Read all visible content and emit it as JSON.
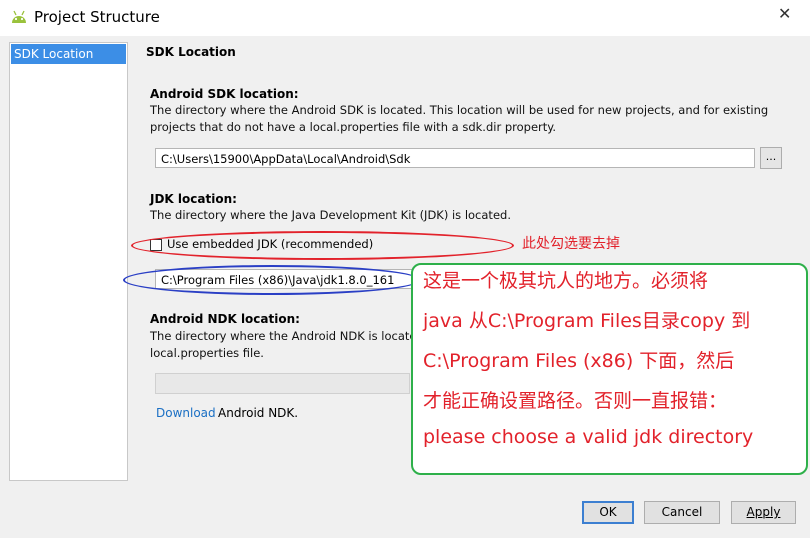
{
  "window": {
    "title": "Project Structure",
    "close_glyph": "✕"
  },
  "sidebar": {
    "items": [
      {
        "label": "SDK Location"
      }
    ]
  },
  "main": {
    "section_title": "SDK Location",
    "android_sdk": {
      "label": "Android SDK location:",
      "desc_line1": "The directory where the Android SDK is located. This location will be used for new projects, and for existing",
      "desc_line2": "projects that do not have a local.properties file with a sdk.dir property.",
      "path": "C:\\Users\\15900\\AppData\\Local\\Android\\Sdk",
      "browse_label": "..."
    },
    "jdk": {
      "label": "JDK location:",
      "desc": "The directory where the Java Development Kit (JDK) is located.",
      "checkbox_label": "Use embedded JDK (recommended)",
      "checkbox_checked": false,
      "path": "C:\\Program Files (x86)\\Java\\jdk1.8.0_161",
      "browse_label": "..."
    },
    "ndk": {
      "label": "Android NDK location:",
      "desc_line1": "The directory where the Android NDK is located. This location will be saved as ndk.dir property in the",
      "desc_line2": "local.properties file.",
      "path": "",
      "download_link": "Download",
      "download_rest": " Android NDK."
    }
  },
  "footer": {
    "ok": "OK",
    "cancel": "Cancel",
    "apply": "Apply"
  },
  "annotations": {
    "red_note": "此处勾选要去掉",
    "green_lines": [
      "这是一个极其坑人的地方。必须将",
      "java 从C:\\Program Files目录copy 到",
      "C:\\Program Files (x86) 下面，然后",
      "才能正确设置路径。否则一直报错：",
      "please choose a valid jdk directory"
    ],
    "colors": {
      "red": "#e2222b",
      "blue": "#2a3fc5",
      "green": "#2eb04a",
      "selection": "#3c8ee6"
    }
  }
}
